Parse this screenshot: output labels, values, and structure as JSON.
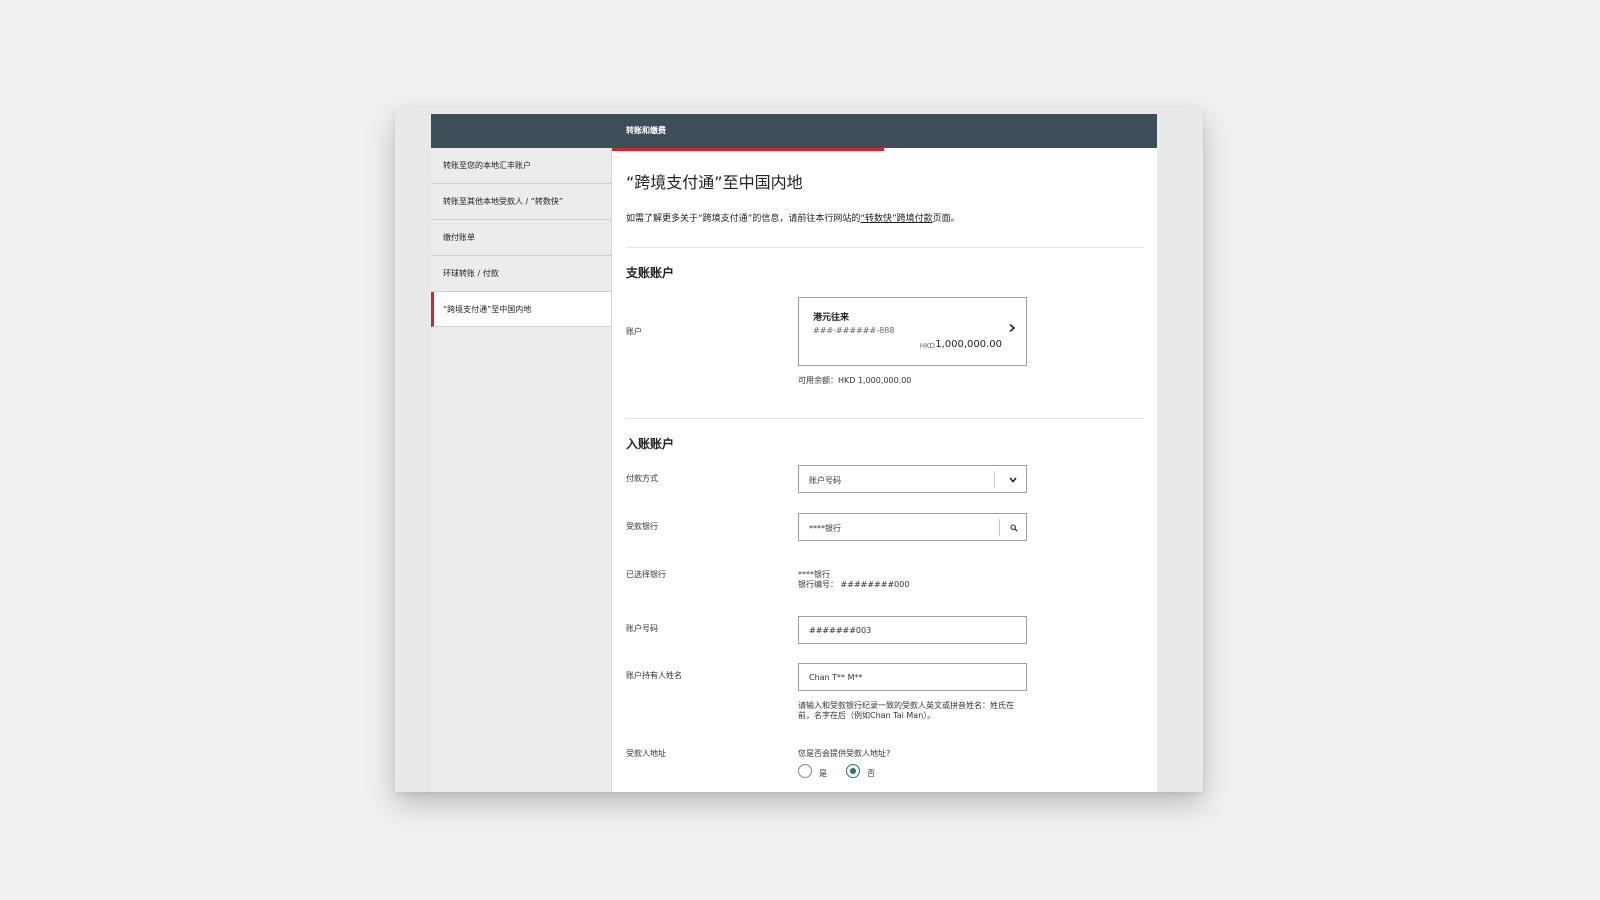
{
  "header": {
    "title": "转账和缴费"
  },
  "sidebar": {
    "items": [
      {
        "label": "转账至您的本地汇丰账户"
      },
      {
        "label": "转账至其他本地受款人 / “转数快”"
      },
      {
        "label": "缴付账单"
      },
      {
        "label": "环球转账 / 付款"
      },
      {
        "label": "“跨境支付通”至中国内地"
      }
    ]
  },
  "page": {
    "title": "“跨境支付通”至中国内地",
    "intro_prefix": "如需了解更多关于“跨境支付通”的信息，请前往本行网站的",
    "intro_link": "“转数快”跨境付款",
    "intro_suffix": "页面。"
  },
  "debit": {
    "section_title": "支账账户",
    "account_label": "账户",
    "account_name": "港元往来",
    "account_number": "###-######-888",
    "currency": "HKD",
    "balance": "1,000,000.00",
    "available": "可用余额：HKD 1,000,000.00"
  },
  "credit": {
    "section_title": "入账账户",
    "method_label": "付款方式",
    "method_value": "账户号码",
    "bank_label": "受款银行",
    "bank_value": "****银行",
    "selected_label": "已选择银行",
    "selected_bank": "****银行",
    "selected_code": "银行编号：  ########000",
    "account_no_label": "账户号码",
    "account_no_value": "#######003",
    "holder_label": "账户持有人姓名",
    "holder_value": "Chan T** M**",
    "holder_hint_1": "请输入和受款银行纪录一致的受款人英文或拼音姓名：姓氏在",
    "holder_hint_2": "前，名字在后（例如Chan Tai Man）。",
    "address_label": "受款人地址",
    "address_question": "您是否会提供受款人地址?",
    "option_yes": "是",
    "option_no": "否",
    "selected_option": "否"
  },
  "colors": {
    "header_bg": "#3d4e59",
    "accent_red": "#d7262b",
    "radio_green": "#2f6f6a"
  }
}
